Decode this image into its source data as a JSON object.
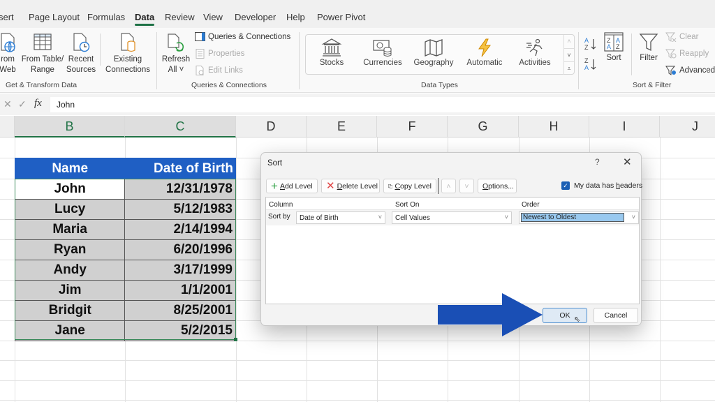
{
  "ribbon": {
    "tabs": [
      {
        "label": "sert",
        "active": false
      },
      {
        "label": "Page Layout",
        "active": false
      },
      {
        "label": "Formulas",
        "active": false
      },
      {
        "label": "Data",
        "active": true
      },
      {
        "label": "Review",
        "active": false
      },
      {
        "label": "View",
        "active": false
      },
      {
        "label": "Developer",
        "active": false
      },
      {
        "label": "Help",
        "active": false
      },
      {
        "label": "Power Pivot",
        "active": false
      }
    ],
    "groups": {
      "get_transform": {
        "label": "Get & Transform Data",
        "buttons": {
          "from_web": {
            "line1": "rom",
            "line2": "Web"
          },
          "from_table": {
            "line1": "From Table/",
            "line2": "Range"
          },
          "recent_sources": {
            "line1": "Recent",
            "line2": "Sources"
          },
          "existing_connections": {
            "line1": "Existing",
            "line2": "Connections"
          }
        }
      },
      "queries": {
        "label": "Queries & Connections",
        "refresh_all": {
          "line1": "Refresh",
          "line2": "All ˅"
        },
        "queries_connections": "Queries & Connections",
        "properties": "Properties",
        "edit_links": "Edit Links"
      },
      "data_types": {
        "label": "Data Types",
        "items": [
          "Stocks",
          "Currencies",
          "Geography",
          "Automatic",
          "Activities"
        ]
      },
      "sort_filter": {
        "label": "Sort & Filter",
        "sort": "Sort",
        "filter": "Filter",
        "clear": "Clear",
        "reapply": "Reapply",
        "advanced": "Advanced"
      }
    }
  },
  "formula_bar": {
    "fx": "fx",
    "value": "John"
  },
  "columns": [
    "B",
    "C",
    "D",
    "E",
    "F",
    "G",
    "H",
    "I",
    "J"
  ],
  "table": {
    "headers": [
      "Name",
      "Date of Birth"
    ],
    "rows": [
      [
        "John",
        "12/31/1978"
      ],
      [
        "Lucy",
        "5/12/1983"
      ],
      [
        "Maria",
        "2/14/1994"
      ],
      [
        "Ryan",
        "6/20/1996"
      ],
      [
        "Andy",
        "3/17/1999"
      ],
      [
        "Jim",
        "1/1/2001"
      ],
      [
        "Bridgit",
        "8/25/2001"
      ],
      [
        "Jane",
        "5/2/2015"
      ]
    ]
  },
  "sort_dialog": {
    "title": "Sort",
    "help": "?",
    "close": "✕",
    "toolbar": {
      "add_level": {
        "accel": "A",
        "rest": "dd Level"
      },
      "delete_level": {
        "accel": "D",
        "rest": "elete Level"
      },
      "copy_level": {
        "accel": "C",
        "rest": "opy Level"
      },
      "move_up": "˄",
      "move_down": "˅",
      "options": {
        "accel": "O",
        "rest": "ptions..."
      }
    },
    "my_data_has_headers": {
      "pre": "My data has ",
      "accel": "h",
      "rest": "eaders",
      "checked": true
    },
    "columns_header": {
      "column": "Column",
      "sort_on": "Sort On",
      "order": "Order"
    },
    "level": {
      "label": "Sort by",
      "column": "Date of Birth",
      "sort_on": "Cell Values",
      "order": "Newest to Oldest"
    },
    "ok": "OK",
    "cancel": "Cancel"
  },
  "colors": {
    "accent_green": "#217346",
    "table_header_blue": "#1f5fc4",
    "arrow_blue": "#1a4fb5",
    "selected_cell_gray": "#d0d0d0"
  }
}
